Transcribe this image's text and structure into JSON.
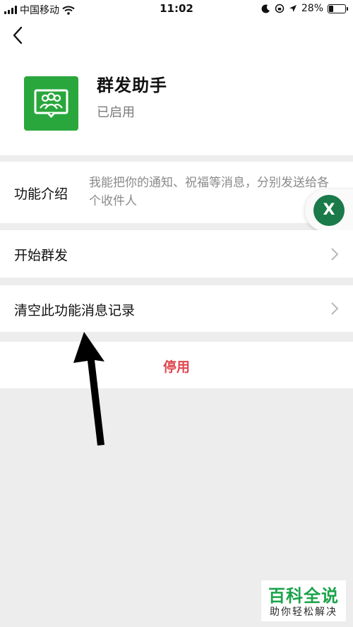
{
  "status_bar": {
    "carrier": "中国移动",
    "time": "11:02",
    "battery": "28%",
    "battery_level": 0.28
  },
  "header": {
    "app_name": "群发助手",
    "app_status": "已启用"
  },
  "intro": {
    "label": "功能介绍",
    "text": "我能把你的通知、祝福等消息，分别发送给各个收件人"
  },
  "menu": {
    "start_label": "开始群发",
    "clear_label": "清空此功能消息记录",
    "disable_label": "停用"
  },
  "floating": {
    "label": "X"
  },
  "watermark": {
    "title": "百科全说",
    "subtitle": "助你轻松解决"
  },
  "colors": {
    "accent_green": "#2aa73c",
    "danger_red": "#e0464f",
    "float_green": "#1a7a49"
  }
}
